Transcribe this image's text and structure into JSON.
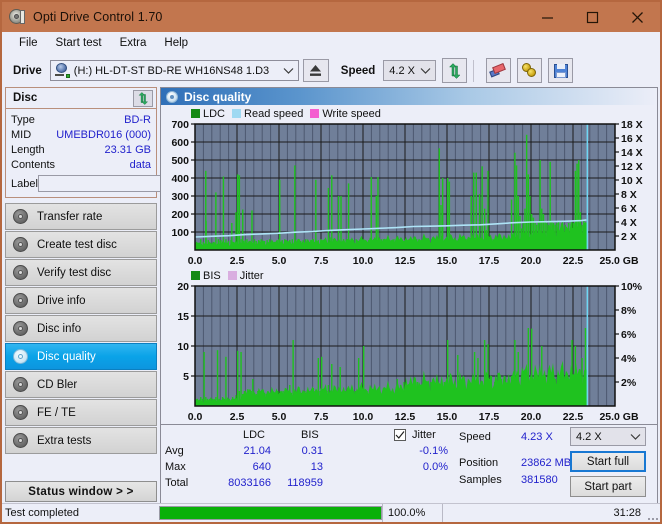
{
  "window": {
    "title": "Opti Drive Control 1.70",
    "icon": "disc-icon",
    "minimize": "minimize-icon",
    "maximize": "maximize-icon",
    "close": "close-icon"
  },
  "menubar": {
    "items": [
      "File",
      "Start test",
      "Extra",
      "Help"
    ]
  },
  "toolbar": {
    "drive_label": "Drive",
    "drive_value": "(H:)   HL-DT-ST BD-RE  WH16NS48 1.D3",
    "eject_icon": "eject-icon",
    "speed_label": "Speed",
    "speed_value": "4.2 X",
    "refresh_icon": "refresh-icon",
    "erase_icon": "eraser-icon",
    "scan_icon": "gold-discs-icon",
    "save_icon": "floppy-save-icon"
  },
  "disc_panel": {
    "title": "Disc",
    "refresh_icon": "refresh-icon",
    "rows": [
      {
        "key": "Type",
        "value": "BD-R"
      },
      {
        "key": "MID",
        "value": "UMEBDR016 (000)"
      },
      {
        "key": "Length",
        "value": "23.31 GB"
      },
      {
        "key": "Contents",
        "value": "data"
      }
    ],
    "label_key": "Label",
    "label_value": "",
    "label_placeholder": "",
    "label_button_icon": "cd-icon"
  },
  "nav": {
    "items": [
      {
        "label": "Transfer rate",
        "icon": "disc-icon",
        "active": false
      },
      {
        "label": "Create test disc",
        "icon": "disc-icon",
        "active": false
      },
      {
        "label": "Verify test disc",
        "icon": "disc-icon",
        "active": false
      },
      {
        "label": "Drive info",
        "icon": "disc-icon",
        "active": false
      },
      {
        "label": "Disc info",
        "icon": "disc-icon",
        "active": false
      },
      {
        "label": "Disc quality",
        "icon": "disc-icon",
        "active": true
      },
      {
        "label": "CD Bler",
        "icon": "disc-icon",
        "active": false
      },
      {
        "label": "FE / TE",
        "icon": "disc-icon",
        "active": false
      },
      {
        "label": "Extra tests",
        "icon": "disc-icon",
        "active": false
      }
    ],
    "status_window_button": "Status window > >"
  },
  "status": {
    "left_text": "Test completed"
  },
  "main": {
    "title": "Disc quality",
    "title_icon": "disc-icon"
  },
  "stats": {
    "col_ldc": "LDC",
    "col_bis": "BIS",
    "row_avg": "Avg",
    "row_max": "Max",
    "row_total": "Total",
    "avg_ldc": "21.04",
    "avg_bis": "0.31",
    "max_ldc": "640",
    "max_bis": "13",
    "total_ldc": "8033166",
    "total_bis": "118959",
    "jitter_label": "Jitter",
    "jitter_checked": true,
    "jitter_avg": "-0.1%",
    "jitter_max": "0.0%",
    "speed_label": "Speed",
    "speed_value": "4.23 X",
    "position_label": "Position",
    "position_value": "23862 MB",
    "samples_label": "Samples",
    "samples_value": "381580",
    "speed_select": "4.2 X",
    "start_full": "Start full",
    "start_part": "Start part"
  },
  "bottom": {
    "progress_percent": 100,
    "progress_text": "100.0%",
    "elapsed": "31:28"
  },
  "colors": {
    "titlebar": "#c2764e",
    "accent_blue": "#0aa3e8",
    "value_blue": "#2222cc",
    "ldc_green": "#1ca81c",
    "bis_green": "#1ca81c",
    "read_speed": "#9fd9f2",
    "write_speed": "#f45ed0",
    "jitter": "#d9aee0",
    "plot_bg": "#707f99",
    "progress_green": "#09b009"
  },
  "chart_data": [
    {
      "type": "area",
      "title": "Disc quality - LDC / speed",
      "xlabel": "GB",
      "ylabel": "LDC",
      "y2label": "X",
      "xlim": [
        0,
        25
      ],
      "ylim": [
        0,
        700
      ],
      "y2lim": [
        0,
        18
      ],
      "grid": true,
      "legend_position": "top-left",
      "xticks": [
        "0.0",
        "2.5",
        "5.0",
        "7.5",
        "10.0",
        "12.5",
        "15.0",
        "17.5",
        "20.0",
        "22.5",
        "25.0 GB"
      ],
      "yticks": [
        100,
        200,
        300,
        400,
        500,
        600,
        700
      ],
      "y2ticks": [
        "2 X",
        "4 X",
        "6 X",
        "8 X",
        "10 X",
        "12 X",
        "14 X",
        "16 X",
        "18 X"
      ],
      "legend": [
        {
          "name": "LDC",
          "color": "#1ca81c"
        },
        {
          "name": "Read speed",
          "color": "#9fd9f2"
        },
        {
          "name": "Write speed",
          "color": "#f45ed0"
        }
      ],
      "series": [
        {
          "name": "LDC",
          "color": "#1ca81c",
          "x": [
            0.0,
            0.15,
            0.3,
            0.45,
            0.6,
            0.62,
            0.75,
            0.9,
            1.05,
            1.2,
            1.35,
            1.45,
            1.5,
            1.65,
            1.8,
            1.95,
            2.1,
            2.15,
            2.25,
            2.4,
            2.5,
            2.6,
            2.7,
            2.8,
            2.85,
            2.95,
            3.05,
            3.2,
            3.35,
            3.5,
            3.6,
            3.75,
            3.9,
            4.0,
            4.1,
            4.25,
            4.4,
            4.55,
            4.7,
            4.85,
            4.95,
            5.0,
            5.15,
            5.3,
            5.45,
            5.6,
            5.75,
            5.9,
            5.95,
            6.1,
            6.25,
            6.4,
            6.55,
            6.7,
            6.85,
            7.0,
            7.15,
            7.3,
            7.45,
            7.6,
            7.75,
            7.9,
            8.0,
            8.1,
            8.2,
            8.35,
            8.5,
            8.65,
            8.8,
            8.95,
            9.0,
            9.1,
            9.25,
            9.4,
            9.55,
            9.7,
            9.85,
            10.0,
            10.15,
            10.3,
            10.45,
            10.6,
            10.75,
            10.85,
            10.9,
            11.05,
            11.2,
            11.35,
            11.5,
            11.65,
            11.8,
            11.95,
            12.1,
            12.25,
            12.4,
            12.55,
            12.7,
            12.85,
            13.0,
            13.15,
            13.3,
            13.45,
            13.6,
            13.75,
            13.9,
            14.05,
            14.2,
            14.35,
            14.5,
            14.6,
            14.7,
            14.85,
            15.0,
            15.1,
            15.2,
            15.35,
            15.5,
            15.65,
            15.8,
            15.95,
            16.1,
            16.25,
            16.4,
            16.55,
            16.7,
            16.8,
            16.9,
            17.05,
            17.2,
            17.3,
            17.4,
            17.5,
            17.6,
            17.7,
            17.85,
            18.0,
            18.2,
            18.4,
            18.6,
            18.8,
            19.0,
            19.1,
            19.2,
            19.3,
            19.4,
            19.5,
            19.6,
            19.7,
            19.8,
            19.9,
            20.0,
            20.1,
            20.2,
            20.3,
            20.4,
            20.5,
            20.6,
            20.7,
            20.8,
            20.9,
            21.0,
            21.1,
            21.2,
            21.3,
            21.4,
            21.5,
            21.6,
            21.8,
            22.0,
            22.2,
            22.4,
            22.5,
            22.6,
            22.7,
            22.8,
            22.9,
            23.0,
            23.1,
            23.2,
            23.3
          ],
          "values": [
            30,
            40,
            60,
            45,
            440,
            160,
            55,
            40,
            45,
            320,
            60,
            50,
            55,
            408,
            60,
            50,
            55,
            150,
            45,
            210,
            420,
            415,
            60,
            225,
            50,
            55,
            60,
            50,
            220,
            60,
            50,
            55,
            60,
            45,
            50,
            55,
            60,
            50,
            45,
            55,
            60,
            390,
            55,
            60,
            50,
            55,
            60,
            470,
            55,
            60,
            50,
            55,
            60,
            50,
            55,
            60,
            390,
            55,
            60,
            50,
            55,
            345,
            70,
            415,
            60,
            50,
            300,
            300,
            60,
            55,
            60,
            370,
            60,
            55,
            60,
            50,
            55,
            60,
            50,
            55,
            405,
            60,
            300,
            405,
            70,
            60,
            55,
            60,
            50,
            55,
            60,
            50,
            55,
            60,
            50,
            55,
            60,
            50,
            55,
            60,
            50,
            55,
            60,
            50,
            55,
            60,
            50,
            55,
            565,
            250,
            400,
            60,
            400,
            380,
            60,
            50,
            55,
            60,
            50,
            55,
            60,
            50,
            300,
            430,
            430,
            60,
            310,
            465,
            230,
            110,
            440,
            60,
            55,
            60,
            50,
            55,
            60,
            50,
            55,
            280,
            540,
            470,
            300,
            190,
            120,
            150,
            230,
            640,
            420,
            300,
            200,
            180,
            150,
            140,
            160,
            500,
            230,
            200,
            160,
            150,
            140,
            490,
            160,
            150,
            140,
            150,
            160,
            150,
            140,
            150,
            160,
            150,
            440,
            480,
            500,
            210,
            140,
            170
          ]
        },
        {
          "name": "Read speed",
          "color": "#9fd9f2",
          "x": [
            0.0,
            1.0,
            2.0,
            3.0,
            4.0,
            5.0,
            6.0,
            7.0,
            8.0,
            9.0,
            10.0,
            11.0,
            12.0,
            13.0,
            14.0,
            15.0,
            16.0,
            17.0,
            18.0,
            19.0,
            20.0,
            21.0,
            22.0,
            23.0,
            23.3
          ],
          "values_x": [
            1.85,
            1.95,
            2.05,
            2.2,
            2.3,
            2.4,
            2.55,
            2.65,
            2.8,
            2.9,
            3.0,
            3.1,
            3.2,
            3.35,
            3.4,
            3.45,
            3.55,
            3.6,
            3.75,
            3.9,
            4.0,
            4.05,
            4.1,
            4.2,
            4.3
          ]
        },
        {
          "name": "Write speed",
          "color": "#f45ed0",
          "x": [],
          "values": []
        }
      ]
    },
    {
      "type": "area",
      "title": "Disc quality - BIS / jitter",
      "xlabel": "GB",
      "ylabel": "BIS",
      "y2label": "%",
      "xlim": [
        0,
        25
      ],
      "ylim": [
        0,
        20
      ],
      "y2lim": [
        0,
        10
      ],
      "grid": true,
      "legend_position": "top-left",
      "xticks": [
        "0.0",
        "2.5",
        "5.0",
        "7.5",
        "10.0",
        "12.5",
        "15.0",
        "17.5",
        "20.0",
        "22.5",
        "25.0 GB"
      ],
      "yticks": [
        5,
        10,
        15,
        20
      ],
      "y2ticks": [
        "2%",
        "4%",
        "6%",
        "8%",
        "10%"
      ],
      "legend": [
        {
          "name": "BIS",
          "color": "#1ca81c"
        },
        {
          "name": "Jitter",
          "color": "#d9aee0"
        }
      ],
      "series": [
        {
          "name": "BIS",
          "color": "#1ca81c",
          "x": [
            0.0,
            0.1,
            0.2,
            0.3,
            0.4,
            0.5,
            0.6,
            0.7,
            0.8,
            0.9,
            1.0,
            1.1,
            1.2,
            1.3,
            1.4,
            1.5,
            1.6,
            1.7,
            1.8,
            1.9,
            2.0,
            2.1,
            2.2,
            2.3,
            2.4,
            2.5,
            2.6,
            2.7,
            2.8,
            2.9,
            3.0,
            3.1,
            3.2,
            3.3,
            3.4,
            3.5,
            3.6,
            3.7,
            3.8,
            3.9,
            4.0,
            4.1,
            4.2,
            4.3,
            4.4,
            4.5,
            4.6,
            4.7,
            4.8,
            4.9,
            5.0,
            5.1,
            5.2,
            5.3,
            5.4,
            5.5,
            5.6,
            5.7,
            5.8,
            5.9,
            6.0,
            6.1,
            6.2,
            6.3,
            6.4,
            6.5,
            6.6,
            6.7,
            6.8,
            6.9,
            7.0,
            7.1,
            7.2,
            7.3,
            7.4,
            7.5,
            7.6,
            7.7,
            7.8,
            7.9,
            8.0,
            8.1,
            8.2,
            8.3,
            8.4,
            8.5,
            8.6,
            8.7,
            8.8,
            8.9,
            9.0,
            9.1,
            9.2,
            9.3,
            9.4,
            9.5,
            9.6,
            9.7,
            9.8,
            9.9,
            10.0,
            10.2,
            10.4,
            10.6,
            10.8,
            11.0,
            11.2,
            11.4,
            11.6,
            11.8,
            12.0,
            12.2,
            12.4,
            12.6,
            12.8,
            13.0,
            13.2,
            13.4,
            13.6,
            13.8,
            14.0,
            14.2,
            14.4,
            14.6,
            14.8,
            15.0,
            15.2,
            15.4,
            15.6,
            15.8,
            16.0,
            16.2,
            16.4,
            16.6,
            16.8,
            17.0,
            17.2,
            17.4,
            17.6,
            17.8,
            18.0,
            18.2,
            18.4,
            18.6,
            18.8,
            19.0,
            19.2,
            19.4,
            19.6,
            19.8,
            20.0,
            20.2,
            20.4,
            20.6,
            20.8,
            21.0,
            21.2,
            21.4,
            21.6,
            21.8,
            22.0,
            22.2,
            22.4,
            22.6,
            22.8,
            23.0,
            23.2,
            23.3
          ],
          "values": [
            1.0,
            1.2,
            1.0,
            1.5,
            1.2,
            9.0,
            1.5,
            1.2,
            1.0,
            1.4,
            1.2,
            1.0,
            1.5,
            9.3,
            1.2,
            1.0,
            1.5,
            1.2,
            8.2,
            1.4,
            1.2,
            1.0,
            1.5,
            1.2,
            1.8,
            9.2,
            2.5,
            9.0,
            2.0,
            2.5,
            2.2,
            2.8,
            2.0,
            2.5,
            4.5,
            2.2,
            2.0,
            2.5,
            2.2,
            2.0,
            2.5,
            2.2,
            2.0,
            2.5,
            2.2,
            2.0,
            2.5,
            2.2,
            2.0,
            2.5,
            2.2,
            2.0,
            2.5,
            2.2,
            2.0,
            2.5,
            3.5,
            2.2,
            11.0,
            2.5,
            2.2,
            2.0,
            2.5,
            2.2,
            2.0,
            2.5,
            2.2,
            2.0,
            2.5,
            2.2,
            3.0,
            2.5,
            2.2,
            8.0,
            2.5,
            8.2,
            2.2,
            2.0,
            2.5,
            3.5,
            2.2,
            7.0,
            2.5,
            2.2,
            2.0,
            2.5,
            6.5,
            2.2,
            2.0,
            2.5,
            2.2,
            2.0,
            2.5,
            2.2,
            2.0,
            2.5,
            2.2,
            8.0,
            2.5,
            2.2,
            10.0,
            2.5,
            2.2,
            2.0,
            2.5,
            2.2,
            3.0,
            2.5,
            2.2,
            2.0,
            4.5,
            3.5,
            4.0,
            3.5,
            3.0,
            3.5,
            4.0,
            3.5,
            3.0,
            3.5,
            4.0,
            3.5,
            3.0,
            3.5,
            4.0,
            11.0,
            3.5,
            3.0,
            8.5,
            3.5,
            4.0,
            3.5,
            3.0,
            9.0,
            8.0,
            4.0,
            11.0,
            10.3,
            5.0,
            4.0,
            5.5,
            4.5,
            5.0,
            4.5,
            5.0,
            11.0,
            9.0,
            5.0,
            4.5,
            13.0,
            12.9,
            5.0,
            4.5,
            10.0,
            5.0,
            4.5,
            5.0,
            4.5,
            5.0,
            4.5,
            5.0,
            4.5,
            11.0,
            10.0,
            5.0,
            8.0,
            13.0,
            6.0,
            5.0
          ]
        },
        {
          "name": "Jitter",
          "color": "#d9aee0",
          "x": [],
          "values": []
        }
      ]
    }
  ]
}
